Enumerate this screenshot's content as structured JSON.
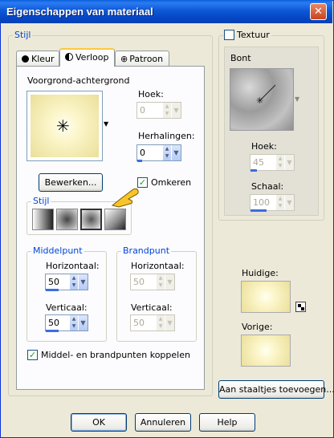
{
  "window": {
    "title": "Eigenschappen van materiaal",
    "close_glyph": "✕"
  },
  "stijl_group": {
    "label": "Stijl"
  },
  "tabs": [
    {
      "label": "Kleur"
    },
    {
      "label": "Verloop"
    },
    {
      "label": "Patroon"
    }
  ],
  "gradient": {
    "preset_label": "Voorgrond-achtergrond",
    "hoek_label": "Hoek:",
    "hoek_value": "0",
    "herhalingen_label": "Herhalingen:",
    "herhalingen_value": "0",
    "bewerken_label": "Bewerken...",
    "omkeren_label": "Omkeren",
    "omkeren_checked": true,
    "style_label": "Stijl"
  },
  "middelpunt": {
    "label": "Middelpunt",
    "horizontaal_label": "Horizontaal:",
    "horizontaal_value": "50",
    "verticaal_label": "Verticaal:",
    "verticaal_value": "50"
  },
  "brandpunt": {
    "label": "Brandpunt",
    "horizontaal_label": "Horizontaal:",
    "horizontaal_value": "50",
    "verticaal_label": "Verticaal:",
    "verticaal_value": "50"
  },
  "koppelen": {
    "label": "Middel- en brandpunten koppelen",
    "checked": true
  },
  "textuur": {
    "label": "Textuur",
    "checked": false,
    "bont_label": "Bont",
    "hoek_label": "Hoek:",
    "hoek_value": "45",
    "schaal_label": "Schaal:",
    "schaal_value": "100"
  },
  "preview": {
    "huidige_label": "Huidige:",
    "vorige_label": "Vorige:"
  },
  "add_swatch_label": "Aan staaltjes toevoegen...",
  "footer": {
    "ok_label": "OK",
    "cancel_label": "Annuleren",
    "help_label": "Help"
  },
  "colors": {
    "title_blue": "#0a5fd8",
    "group_label": "#0046d5",
    "gradient_light": "#fffff0",
    "gradient_dark": "#eadf9a"
  }
}
